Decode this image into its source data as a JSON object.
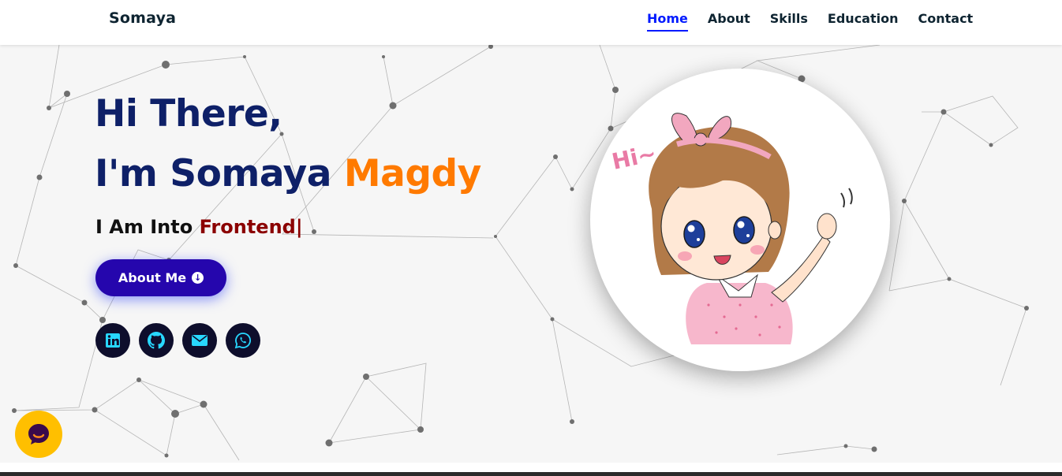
{
  "header": {
    "brand": "Somaya",
    "nav": [
      "Home",
      "About",
      "Skills",
      "Education",
      "Contact"
    ],
    "active": "Home"
  },
  "hero": {
    "greeting": "Hi There,",
    "intro_prefix": "I'm Somaya",
    "intro_highlight": "Magdy",
    "typed_prefix": "I Am Into",
    "typed_word": "Frontend",
    "typed_cursor": "|",
    "button_label": "About Me",
    "socials": [
      "linkedin-icon",
      "github-icon",
      "envelope-icon",
      "whatsapp-icon"
    ],
    "avatar_caption": "Hi~"
  },
  "colors": {
    "heading": "#0e2068",
    "accent": "#ff7a00",
    "typed_word": "#8b0000",
    "button": "#2506ad",
    "nav_active": "#011aff",
    "social_bg": "#0e0e2c",
    "social_icon": "#28d7ff",
    "chat_bubble": "#ffbf00"
  }
}
